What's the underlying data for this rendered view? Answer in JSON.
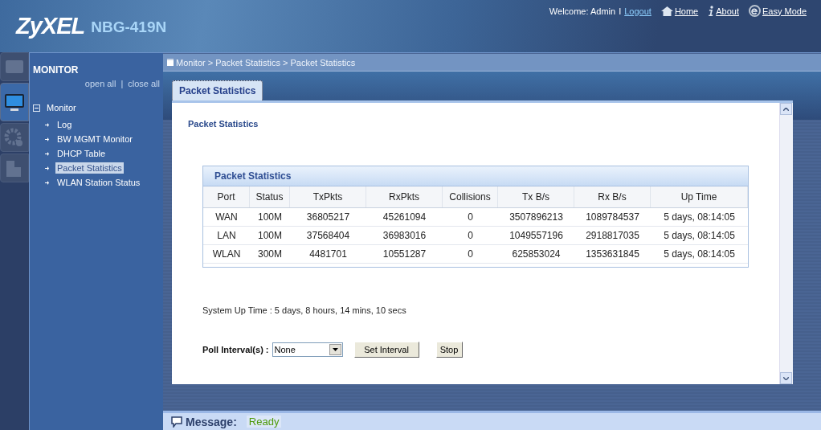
{
  "header": {
    "logo": "ZyXEL",
    "model": "NBG-419N",
    "welcome": "Welcome: Admin",
    "separator": "I",
    "links": [
      {
        "kind": "logout",
        "label": "Logout"
      },
      {
        "kind": "home",
        "label": "Home"
      },
      {
        "kind": "about",
        "label": "About"
      },
      {
        "kind": "easy",
        "label": "Easy Mode"
      }
    ]
  },
  "side_tabs": [
    {
      "kind": "status",
      "selected": false
    },
    {
      "kind": "monitor",
      "selected": true
    },
    {
      "kind": "config",
      "selected": false
    },
    {
      "kind": "maintenance",
      "selected": false
    }
  ],
  "sidebar": {
    "title": "MONITOR",
    "open_all": "open all",
    "divider": "|",
    "close_all": "close all",
    "tree": [
      {
        "label": "Monitor",
        "expanded": true,
        "children": [
          {
            "label": "Log",
            "selected": false
          },
          {
            "label": "BW MGMT Monitor",
            "selected": false
          },
          {
            "label": "DHCP Table",
            "selected": false
          },
          {
            "label": "Packet Statistics",
            "selected": true
          },
          {
            "label": "WLAN Station Status",
            "selected": false
          }
        ]
      }
    ]
  },
  "breadcrumb": "Monitor > Packet Statistics > Packet Statistics",
  "tabs": [
    {
      "label": "Packet Statistics",
      "selected": true
    }
  ],
  "section_title": "Packet Statistics",
  "table": {
    "title": "Packet Statistics",
    "columns": [
      "Port",
      "Status",
      "TxPkts",
      "RxPkts",
      "Collisions",
      "Tx B/s",
      "Rx B/s",
      "Up Time"
    ],
    "rows": [
      [
        "WAN",
        "100M",
        "36805217",
        "45261094",
        "0",
        "3507896213",
        "1089784537",
        "5 days, 08:14:05"
      ],
      [
        "LAN",
        "100M",
        "37568404",
        "36983016",
        "0",
        "1049557196",
        "2918817035",
        "5 days, 08:14:05"
      ],
      [
        "WLAN",
        "300M",
        "4481701",
        "10551287",
        "0",
        "625853024",
        "1353631845",
        "5 days, 08:14:05"
      ]
    ]
  },
  "system_up_time": "System Up Time : 5 days, 8 hours, 14 mins, 10 secs",
  "poll": {
    "label": "Poll Interval(s) :",
    "value": "None",
    "buttons": [
      "Set Interval",
      "Stop"
    ]
  },
  "message": {
    "label": "Message:",
    "value": "Ready"
  }
}
